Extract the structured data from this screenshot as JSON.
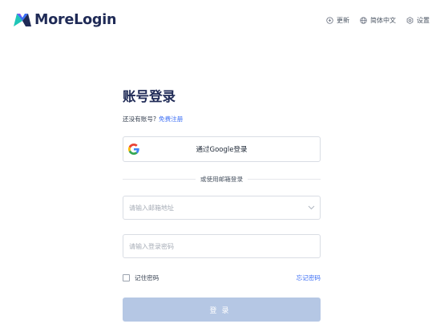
{
  "brand": {
    "name": "MoreLogin"
  },
  "topnav": {
    "update_label": "更新",
    "language_label": "简体中文",
    "settings_label": "设置"
  },
  "login": {
    "title": "账号登录",
    "no_account_text": "还没有账号?",
    "signup_link": "免费注册",
    "google_button": "通过Google登录",
    "divider_text": "或使用邮箱登录",
    "email_placeholder": "请输入邮箱地址",
    "password_placeholder": "请输入登录密码",
    "remember_label": "记住密码",
    "forgot_link": "忘记密码",
    "submit_label": "登录"
  },
  "colors": {
    "brand_text": "#1f2a56",
    "link": "#3b6ef5",
    "submit_disabled": "#b5c7e4"
  }
}
